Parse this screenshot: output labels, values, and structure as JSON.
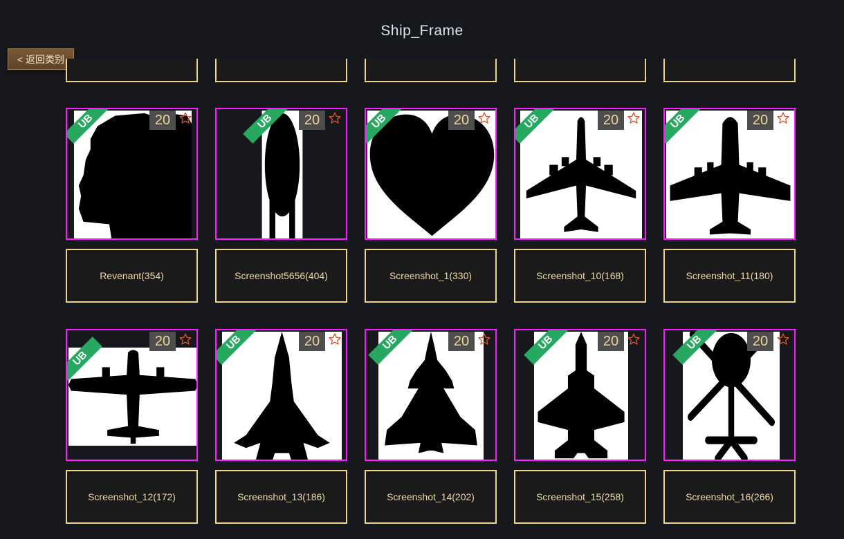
{
  "page": {
    "title": "Ship_Frame"
  },
  "back_button": {
    "label": "< 返回类别"
  },
  "badge": {
    "text": "UB"
  },
  "items": [
    {
      "label": "Revenant(354)",
      "count": "20",
      "shape": "revenant"
    },
    {
      "label": "Screenshot5656(404)",
      "count": "20",
      "shape": "capsule"
    },
    {
      "label": "Screenshot_1(330)",
      "count": "20",
      "shape": "heart"
    },
    {
      "label": "Screenshot_10(168)",
      "count": "20",
      "shape": "airliner"
    },
    {
      "label": "Screenshot_11(180)",
      "count": "20",
      "shape": "transport"
    },
    {
      "label": "Screenshot_12(172)",
      "count": "20",
      "shape": "propplane"
    },
    {
      "label": "Screenshot_13(186)",
      "count": "20",
      "shape": "fighter"
    },
    {
      "label": "Screenshot_14(202)",
      "count": "20",
      "shape": "delta"
    },
    {
      "label": "Screenshot_15(258)",
      "count": "20",
      "shape": "jet"
    },
    {
      "label": "Screenshot_16(266)",
      "count": "20",
      "shape": "drone"
    }
  ],
  "colors": {
    "background": "#16181d",
    "thumb_border": "#ff1cff",
    "label_border": "#f0d48a",
    "label_text": "#efd9a3",
    "badge": "#27a860",
    "count_bg": "#4e4e4e",
    "count_text": "#f3d39a",
    "star": "#d9532c"
  },
  "icons": {
    "favorite": "star-outline-icon"
  }
}
